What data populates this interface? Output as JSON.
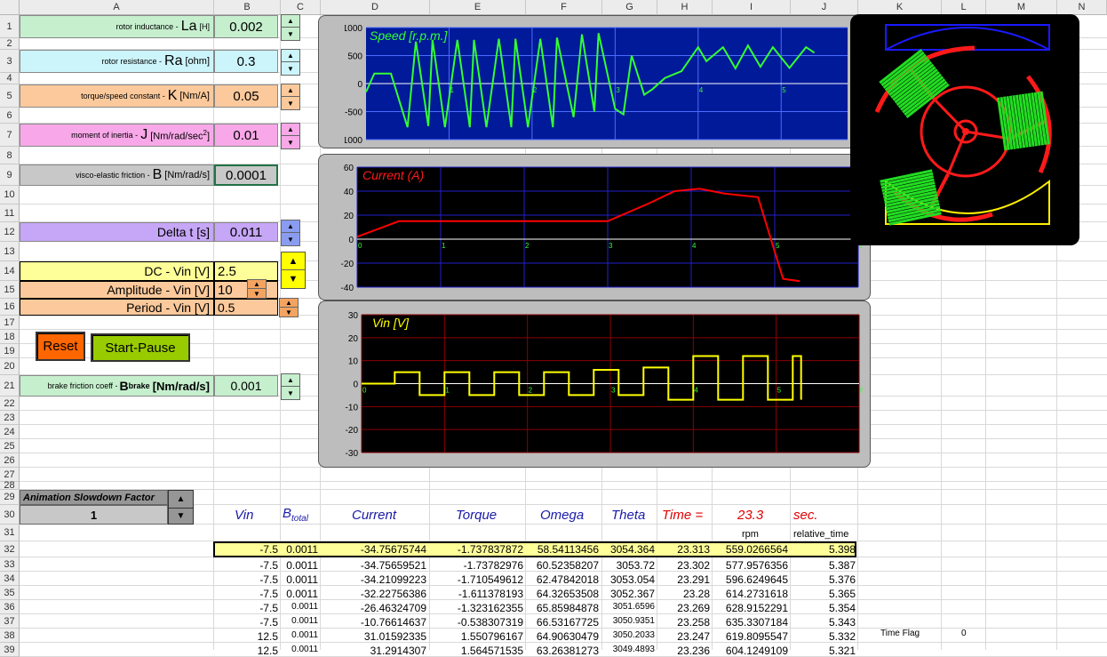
{
  "columns": [
    "A",
    "B",
    "C",
    "D",
    "E",
    "F",
    "G",
    "H",
    "I",
    "J",
    "K",
    "L",
    "M",
    "N"
  ],
  "rows": [
    "1",
    "2",
    "3",
    "4",
    "5",
    "6",
    "7",
    "8",
    "9",
    "10",
    "11",
    "12",
    "13",
    "14",
    "15",
    "16",
    "17",
    "18",
    "19",
    "20",
    "21",
    "22",
    "23",
    "24",
    "25",
    "26",
    "27",
    "28",
    "29",
    "30",
    "31",
    "32",
    "33",
    "34",
    "35",
    "36",
    "37",
    "38",
    "39"
  ],
  "params": {
    "la": {
      "pre": "rotor inductance - ",
      "sym": "La",
      "unit": "[H]",
      "value": "0.002",
      "color": "#c6efce"
    },
    "ra": {
      "pre": "rotor resistance - ",
      "sym": "Ra",
      "unit": "[ohm]",
      "value": "0.3",
      "color": "#ccf5fb"
    },
    "k": {
      "pre": "torque/speed constant - ",
      "sym": "K",
      "unit": "[Nm/A]",
      "value": "0.05",
      "color": "#fbc99b"
    },
    "j": {
      "pre": "moment of inertia - ",
      "sym": "J",
      "unit": "[Nm/rad/sec",
      "sup": "2",
      "unit2": "]",
      "value": "0.01",
      "color": "#f8a8e8"
    },
    "b": {
      "pre": "visco-elastic friction - ",
      "sym": "B",
      "unit": "[Nm/rad/s]",
      "value": "0.0001",
      "color": "#c8c8c8"
    },
    "dt": {
      "label": "Delta t [s]",
      "value": "0.011",
      "color": "#c6a6f6"
    },
    "dc": {
      "label": "DC - Vin [V]",
      "value": "2.5",
      "color": "#ffff99"
    },
    "amp": {
      "label": "Amplitude - Vin [V]",
      "value": "10",
      "color": "#fbc99b"
    },
    "per": {
      "label": "Period - Vin [V]",
      "value": "0.5",
      "color": "#fbc99b"
    },
    "brake": {
      "pre": "brake friction coeff - ",
      "sym": "B",
      "sub": "brake",
      "unit": "[Nm/rad/s]",
      "value": "0.001",
      "color": "#c6efce"
    }
  },
  "buttons": {
    "reset": "Reset",
    "start": "Start-Pause"
  },
  "slowdown": {
    "label": "Animation Slowdown Factor",
    "value": "1"
  },
  "table": {
    "headers": [
      "Vin",
      "B",
      "total",
      "Current",
      "Torque",
      "Omega",
      "Theta",
      "Time =",
      "23.3",
      "sec."
    ],
    "sub": {
      "rpm": "rpm",
      "rel": "relative_time"
    },
    "rows": [
      [
        "-7.5",
        "0.0011",
        "-34.75675744",
        "-1.737837872",
        "58.54113456",
        "3054.364",
        "23.313",
        "559.0266564",
        "5.398"
      ],
      [
        "-7.5",
        "0.0011",
        "-34.75659521",
        "-1.73782976",
        "60.52358207",
        "3053.72",
        "23.302",
        "577.9576356",
        "5.387"
      ],
      [
        "-7.5",
        "0.0011",
        "-34.21099223",
        "-1.710549612",
        "62.47842018",
        "3053.054",
        "23.291",
        "596.6249645",
        "5.376"
      ],
      [
        "-7.5",
        "0.0011",
        "-32.22756386",
        "-1.611378193",
        "64.32653508",
        "3052.367",
        "23.28",
        "614.2731618",
        "5.365"
      ],
      [
        "-7.5",
        "0.0011",
        "-26.46324709",
        "-1.323162355",
        "65.85984878",
        "3051.6596",
        "23.269",
        "628.9152291",
        "5.354"
      ],
      [
        "-7.5",
        "0.0011",
        "-10.76614637",
        "-0.538307319",
        "66.53167725",
        "3050.9351",
        "23.258",
        "635.3307184",
        "5.343"
      ],
      [
        "12.5",
        "0.0011",
        "31.01592335",
        "1.550796167",
        "64.90630479",
        "3050.2033",
        "23.247",
        "619.8095547",
        "5.332"
      ],
      [
        "12.5",
        "0.0011",
        "31.2914307",
        "1.564571535",
        "63.26381273",
        "3049.4893",
        "23.236",
        "604.1249109",
        "5.321"
      ]
    ],
    "timeflag": {
      "label": "Time Flag",
      "value": "0"
    }
  },
  "charts": {
    "speed": {
      "title": "Speed [r.p.m.]",
      "ylim": [
        -1000,
        1000
      ],
      "yticks": [
        "1000",
        "500",
        "0",
        "-500",
        "-1000"
      ],
      "xticks": [
        "1",
        "2",
        "3",
        "4",
        "5"
      ],
      "bg": "#001a99",
      "line": "#33ff33"
    },
    "current": {
      "title": "Current (A)",
      "ylim": [
        -40,
        60
      ],
      "yticks": [
        "60",
        "40",
        "20",
        "0",
        "-20",
        "-40"
      ],
      "xticks": [
        "0",
        "1",
        "2",
        "3",
        "4",
        "5",
        "6"
      ],
      "bg": "#000000",
      "line": "#ff0000"
    },
    "vin": {
      "title": "Vin [V]",
      "ylim": [
        -30,
        30
      ],
      "yticks": [
        "30",
        "20",
        "10",
        "0",
        "-10",
        "-20",
        "-30"
      ],
      "xticks": [
        "0",
        "1",
        "2",
        "3",
        "4",
        "5",
        "6"
      ],
      "bg": "#000000",
      "line": "#ffff00"
    }
  },
  "chart_data": [
    {
      "type": "line",
      "title": "Speed [r.p.m.]",
      "ylim": [
        -1000,
        1000
      ],
      "x": [
        0,
        0.1,
        0.3,
        0.5,
        0.6,
        0.75,
        0.8,
        0.95,
        1.1,
        1.25,
        1.3,
        1.45,
        1.6,
        1.75,
        1.8,
        1.95,
        2.1,
        2.25,
        2.3,
        2.5,
        2.6,
        2.75,
        2.8,
        3.0,
        3.1,
        3.2,
        3.35,
        3.45,
        3.6,
        3.8,
        4.0,
        4.1,
        4.3,
        4.45,
        4.6,
        4.75,
        4.9,
        5.1,
        5.3,
        5.4
      ],
      "values": [
        -150,
        180,
        180,
        -780,
        750,
        -760,
        780,
        -780,
        780,
        -780,
        780,
        -780,
        800,
        -780,
        800,
        -780,
        800,
        -780,
        820,
        -600,
        880,
        -500,
        900,
        -450,
        -550,
        500,
        -200,
        -100,
        100,
        220,
        650,
        400,
        650,
        270,
        680,
        300,
        650,
        280,
        650,
        550
      ]
    },
    {
      "type": "line",
      "title": "Current (A)",
      "ylim": [
        -40,
        60
      ],
      "x": [
        0,
        0.5,
        1,
        1.5,
        2,
        2.5,
        3,
        3.5,
        3.8,
        4.1,
        4.4,
        4.8,
        5.1,
        5.3
      ],
      "values": [
        2,
        15,
        15,
        15,
        15,
        15,
        15,
        30,
        40,
        42,
        38,
        35,
        -33,
        -35
      ]
    },
    {
      "type": "line",
      "title": "Vin [V]",
      "ylim": [
        -30,
        30
      ],
      "x": [
        0,
        0.4,
        0.7,
        1.0,
        1.3,
        1.6,
        1.9,
        2.2,
        2.5,
        2.8,
        3.1,
        3.4,
        3.7,
        4.0,
        4.3,
        4.6,
        4.9,
        5.2,
        5.3
      ],
      "values": [
        0,
        5,
        -5,
        5,
        -5,
        5,
        -5,
        5,
        -5,
        6,
        -5,
        7,
        -7,
        12,
        -7,
        12,
        -7,
        12,
        -7
      ]
    }
  ]
}
